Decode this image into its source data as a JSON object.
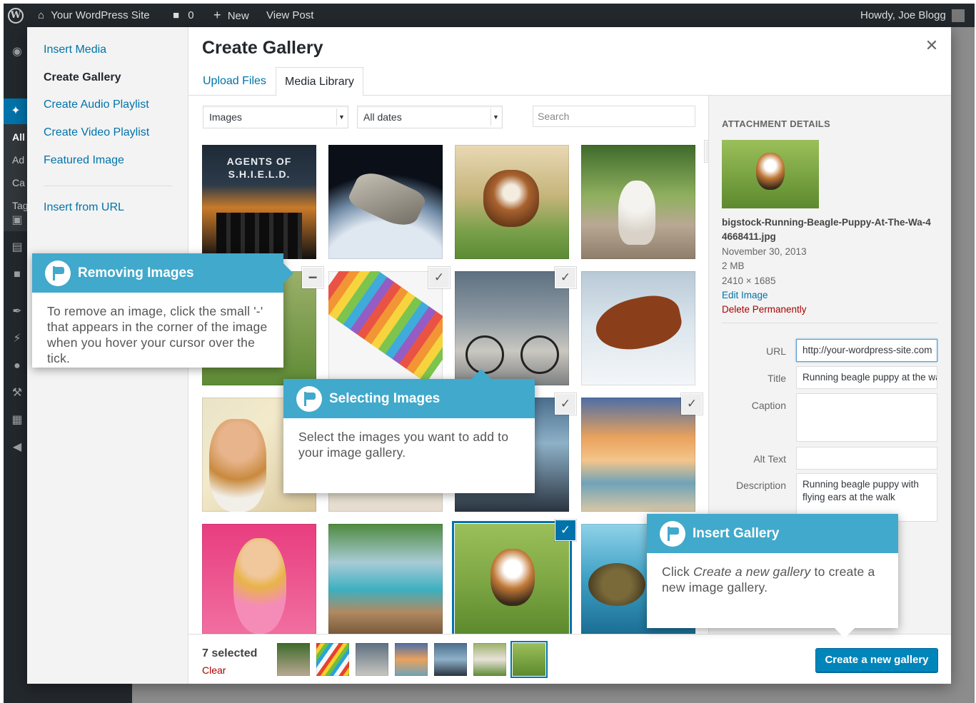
{
  "adminbar": {
    "site": "Your WordPress Site",
    "comments_count": "0",
    "new": "New",
    "view_post": "View Post",
    "howdy": "Howdy, Joe Blogg"
  },
  "adminmenu": {
    "sub_items": [
      "All",
      "Ad",
      "Ca",
      "Tag"
    ]
  },
  "modal": {
    "title": "Create Gallery",
    "menu": [
      {
        "label": "Insert Media"
      },
      {
        "label": "Create Gallery"
      },
      {
        "label": "Create Audio Playlist"
      },
      {
        "label": "Create Video Playlist"
      },
      {
        "label": "Featured Image"
      },
      {
        "label": "Insert from URL"
      }
    ],
    "tabs": {
      "upload": "Upload Files",
      "library": "Media Library"
    },
    "filter_type": "Images",
    "filter_date": "All dates",
    "search_placeholder": "Search"
  },
  "grid": [
    {
      "name": "shield-poster",
      "text": "AGENTS OF S.H.I.E.L.D.",
      "selected": false
    },
    {
      "name": "spaceship",
      "selected": false
    },
    {
      "name": "boxer-puppy",
      "selected": false
    },
    {
      "name": "white-cat",
      "selected": true
    },
    {
      "name": "hidden-behind-callout",
      "selected": true
    },
    {
      "name": "colored-pencils",
      "selected": true
    },
    {
      "name": "bicycle",
      "selected": true
    },
    {
      "name": "horse-in-snow",
      "selected": false
    },
    {
      "name": "woman-headphones",
      "selected": false
    },
    {
      "name": "hidden-2",
      "selected": false
    },
    {
      "name": "pier-sunset",
      "selected": true
    },
    {
      "name": "beach-sunset",
      "selected": true
    },
    {
      "name": "bubblegum-girl",
      "selected": false
    },
    {
      "name": "tropical-boat",
      "selected": false
    },
    {
      "name": "beagle-puppy",
      "selected": true
    },
    {
      "name": "sea-turtle",
      "selected": false
    }
  ],
  "details": {
    "heading": "ATTACHMENT DETAILS",
    "filename": "bigstock-Running-Beagle-Puppy-At-The-Wa-44668411.jpg",
    "date": "November 30, 2013",
    "size": "2 MB",
    "dimensions": "2410 × 1685",
    "edit": "Edit Image",
    "delete": "Delete Permanently",
    "fields": {
      "url_label": "URL",
      "url_value": "http://your-wordpress-site.com",
      "title_label": "Title",
      "title_value": "Running beagle puppy at the walk",
      "caption_label": "Caption",
      "caption_value": "",
      "alt_label": "Alt Text",
      "alt_value": "",
      "desc_label": "Description",
      "desc_value": "Running beagle puppy with flying ears at the walk"
    }
  },
  "bottom": {
    "count": "7 selected",
    "clear": "Clear",
    "button": "Create a new gallery"
  },
  "callouts": {
    "removing": {
      "title": "Removing Images",
      "body": "To remove an image, click the small '-' that appears in the corner of the image when you hover your cursor over the tick."
    },
    "selecting": {
      "title": "Selecting Images",
      "body": "Select the images you want to add to your image gallery."
    },
    "insert": {
      "title": "Insert Gallery",
      "body_before": "Click ",
      "body_em": "Create a new gallery",
      "body_after": " to create a new image gallery."
    }
  },
  "colors": {
    "accent": "#0073aa",
    "callout": "#41a9cb",
    "danger": "#a00"
  }
}
